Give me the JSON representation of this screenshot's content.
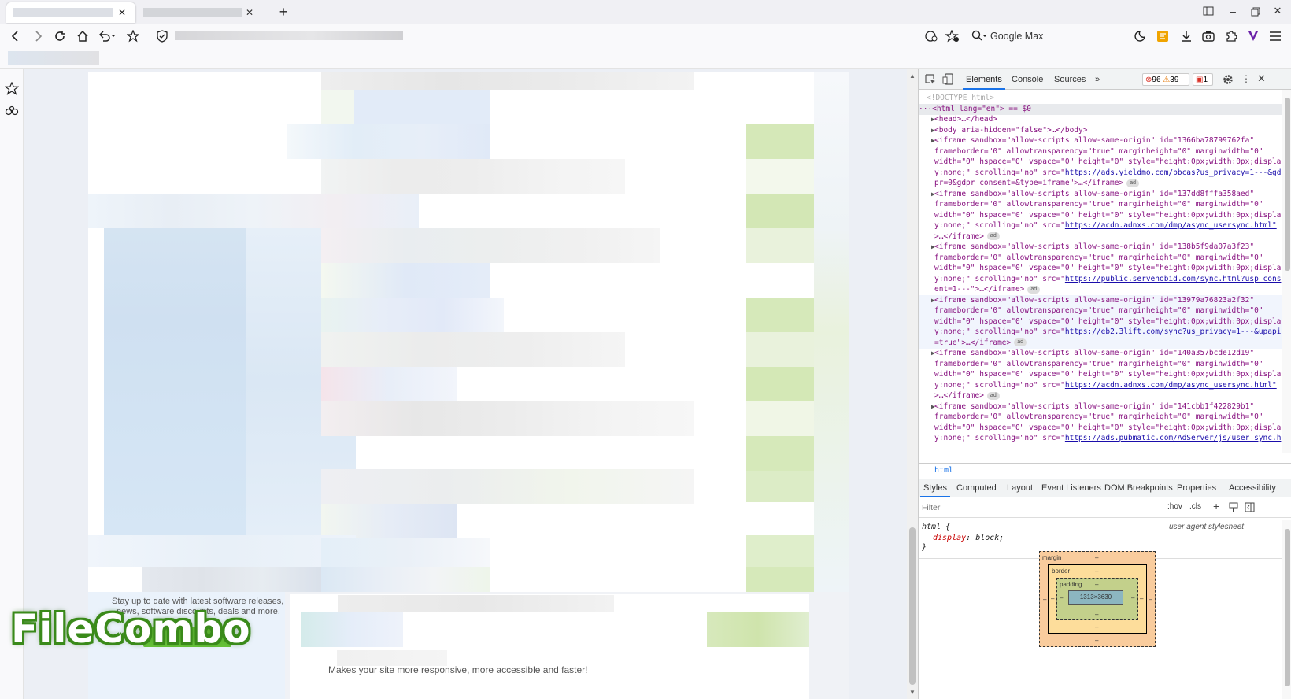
{
  "browser": {
    "search_engine_placeholder": "Google Max",
    "tab_new_label": "+",
    "icons": [
      "back-icon",
      "forward-icon",
      "reload-icon",
      "home-icon",
      "undo-icon",
      "star-icon",
      "shield-icon",
      "translate-icon",
      "bookmark-star-icon",
      "search-icon",
      "clock-icon",
      "extension-icon",
      "download-icon",
      "screenshot-icon",
      "puzzle-icon",
      "v-icon",
      "menu-icon"
    ]
  },
  "page": {
    "newsletter_text_line1": "Stay up to date with latest software releases,",
    "newsletter_text_line2": "news, software discounts, deals and more.",
    "bottom_text": "Makes your site more responsive, more accessible and faster!",
    "watermark": "FileCombo"
  },
  "devtools": {
    "tabs": [
      {
        "label": "Elements",
        "active": true
      },
      {
        "label": "Console",
        "active": false
      },
      {
        "label": "Sources",
        "active": false
      },
      {
        "label": "»",
        "active": false
      }
    ],
    "errors": "96",
    "warnings": "39",
    "issues": "1",
    "dom_lines": [
      {
        "text": "<!DOCTYPE html>",
        "cls": "dim",
        "tri": ""
      },
      {
        "text": "···<html lang=\"en\"> == $0",
        "cls": "sel",
        "tri": ""
      },
      {
        "text": "<head>…</head>",
        "cls": "",
        "tri": "▶"
      },
      {
        "text": "<body aria-hidden=\"false\">…</body>",
        "cls": "",
        "tri": "▶"
      },
      {
        "text": "<iframe sandbox=\"allow-scripts allow-same-origin\" id=\"1366ba78799762fa\"",
        "cls": "",
        "tri": "▶"
      },
      {
        "text": "frameborder=\"0\" allowtransparency=\"true\" marginheight=\"0\" marginwidth=\"0\"",
        "cls": "",
        "tri": ""
      },
      {
        "text": "width=\"0\" hspace=\"0\" vspace=\"0\" height=\"0\" style=\"height:0px;width:0px;displa",
        "cls": "",
        "tri": ""
      },
      {
        "text": "y:none;\" scrolling=\"no\" src=\"https://ads.yieldmo.com/pbcas?us_privacy=1---&gd",
        "cls": "",
        "tri": ""
      },
      {
        "text": "pr=0&gdpr_consent=&type=iframe\">…</iframe>",
        "cls": "",
        "tri": ""
      },
      {
        "text": "<iframe sandbox=\"allow-scripts allow-same-origin\" id=\"137dd8fffa358aed\"",
        "cls": "",
        "tri": "▶"
      },
      {
        "text": "frameborder=\"0\" allowtransparency=\"true\" marginheight=\"0\" marginwidth=\"0\"",
        "cls": "",
        "tri": ""
      },
      {
        "text": "width=\"0\" hspace=\"0\" vspace=\"0\" height=\"0\" style=\"height:0px;width:0px;displa",
        "cls": "",
        "tri": ""
      },
      {
        "text": "y:none;\" scrolling=\"no\" src=\"https://acdn.adnxs.com/dmp/async_usersync.html\"",
        "cls": "",
        "tri": ""
      },
      {
        "text": ">…</iframe>",
        "cls": "",
        "tri": ""
      },
      {
        "text": "<iframe sandbox=\"allow-scripts allow-same-origin\" id=\"138b5f9da07a3f23\"",
        "cls": "",
        "tri": "▶"
      },
      {
        "text": "frameborder=\"0\" allowtransparency=\"true\" marginheight=\"0\" marginwidth=\"0\"",
        "cls": "",
        "tri": ""
      },
      {
        "text": "width=\"0\" hspace=\"0\" vspace=\"0\" height=\"0\" style=\"height:0px;width:0px;displa",
        "cls": "",
        "tri": ""
      },
      {
        "text": "y:none;\" scrolling=\"no\" src=\"https://public.servenobid.com/sync.html?usp_cons",
        "cls": "",
        "tri": ""
      },
      {
        "text": "ent=1---\">…</iframe>",
        "cls": "",
        "tri": ""
      },
      {
        "text": "<iframe sandbox=\"allow-scripts allow-same-origin\" id=\"13979a76823a2f32\"",
        "cls": "hl",
        "tri": "▶"
      },
      {
        "text": "frameborder=\"0\" allowtransparency=\"true\" marginheight=\"0\" marginwidth=\"0\"",
        "cls": "hl",
        "tri": ""
      },
      {
        "text": "width=\"0\" hspace=\"0\" vspace=\"0\" height=\"0\" style=\"height:0px;width:0px;displa",
        "cls": "hl",
        "tri": ""
      },
      {
        "text": "y:none;\" scrolling=\"no\" src=\"https://eb2.3lift.com/sync?us_privacy=1---&upapi",
        "cls": "hl",
        "tri": ""
      },
      {
        "text": "=true\">…</iframe>",
        "cls": "hl",
        "tri": ""
      },
      {
        "text": "<iframe sandbox=\"allow-scripts allow-same-origin\" id=\"140a357bcde12d19\"",
        "cls": "",
        "tri": "▶"
      },
      {
        "text": "frameborder=\"0\" allowtransparency=\"true\" marginheight=\"0\" marginwidth=\"0\"",
        "cls": "",
        "tri": ""
      },
      {
        "text": "width=\"0\" hspace=\"0\" vspace=\"0\" height=\"0\" style=\"height:0px;width:0px;displa",
        "cls": "",
        "tri": ""
      },
      {
        "text": "y:none;\" scrolling=\"no\" src=\"https://acdn.adnxs.com/dmp/async_usersync.html\"",
        "cls": "",
        "tri": ""
      },
      {
        "text": ">…</iframe>",
        "cls": "",
        "tri": ""
      },
      {
        "text": "<iframe sandbox=\"allow-scripts allow-same-origin\" id=\"141cbb1f422829b1\"",
        "cls": "",
        "tri": "▶"
      },
      {
        "text": "frameborder=\"0\" allowtransparency=\"true\" marginheight=\"0\" marginwidth=\"0\"",
        "cls": "",
        "tri": ""
      },
      {
        "text": "width=\"0\" hspace=\"0\" vspace=\"0\" height=\"0\" style=\"height:0px;width:0px;displa",
        "cls": "",
        "tri": ""
      },
      {
        "text": "y:none;\" scrolling=\"no\" src=\"https://ads.pubmatic.com/AdServer/js/user_sync.h",
        "cls": "",
        "tri": ""
      }
    ],
    "ad_badge": "ad",
    "breadcrumb": "html",
    "style_tabs": [
      {
        "label": "Styles",
        "active": true
      },
      {
        "label": "Computed",
        "active": false
      },
      {
        "label": "Layout",
        "active": false
      },
      {
        "label": "Event Listeners",
        "active": false
      },
      {
        "label": "DOM Breakpoints",
        "active": false
      },
      {
        "label": "Properties",
        "active": false
      },
      {
        "label": "Accessibility",
        "active": false
      }
    ],
    "filter_placeholder": "Filter",
    "hov": ":hov",
    "cls": ".cls",
    "rule_selector": "html {",
    "rule_prop": "display",
    "rule_value": "block;",
    "rule_close": "}",
    "rule_source": "user agent stylesheet",
    "boxmodel": {
      "margin": "margin",
      "border": "border",
      "padding": "padding",
      "content": "1313×3630",
      "dash": "–"
    }
  }
}
